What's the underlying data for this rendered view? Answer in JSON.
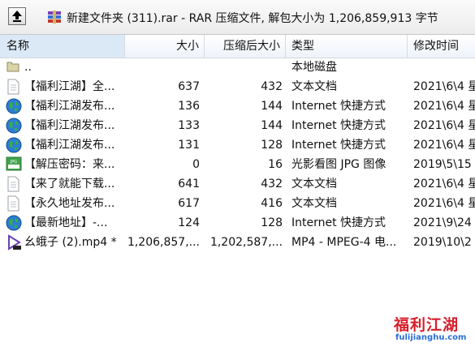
{
  "window": {
    "path_title": "新建文件夹 (311).rar - RAR 压缩文件, 解包大小为 1,206,859,913 字节"
  },
  "columns": {
    "name": "名称",
    "size": "大小",
    "packed": "压缩后大小",
    "type": "类型",
    "modified": "修改时间"
  },
  "files": [
    {
      "icon": "folder-icon",
      "name": "..",
      "size": "",
      "packed": "",
      "type": "本地磁盘",
      "modified": ""
    },
    {
      "icon": "text-document-icon",
      "name": "【福利江湖】全...",
      "size": "637",
      "packed": "432",
      "type": "文本文档",
      "modified": "2021\\6\\4 星"
    },
    {
      "icon": "internet-shortcut-icon",
      "name": "【福利江湖发布...",
      "size": "136",
      "packed": "144",
      "type": "Internet 快捷方式",
      "modified": "2021\\6\\4 星"
    },
    {
      "icon": "internet-shortcut-icon",
      "name": "【福利江湖发布...",
      "size": "133",
      "packed": "144",
      "type": "Internet 快捷方式",
      "modified": "2021\\6\\4 星"
    },
    {
      "icon": "internet-shortcut-icon",
      "name": "【福利江湖发布...",
      "size": "131",
      "packed": "128",
      "type": "Internet 快捷方式",
      "modified": "2021\\6\\4 星"
    },
    {
      "icon": "jpg-image-icon",
      "name": "【解压密码：来...",
      "size": "0",
      "packed": "16",
      "type": "光影看图 JPG 图像",
      "modified": "2019\\5\\15"
    },
    {
      "icon": "text-document-icon",
      "name": "【来了就能下载...",
      "size": "641",
      "packed": "432",
      "type": "文本文档",
      "modified": "2021\\6\\4 星"
    },
    {
      "icon": "text-document-icon",
      "name": "【永久地址发布...",
      "size": "617",
      "packed": "416",
      "type": "文本文档",
      "modified": "2021\\6\\4 星"
    },
    {
      "icon": "internet-shortcut-icon",
      "name": "【最新地址】-...",
      "size": "124",
      "packed": "128",
      "type": "Internet 快捷方式",
      "modified": "2021\\9\\24"
    },
    {
      "icon": "video-file-icon",
      "name": "幺蛾子 (2).mp4 *",
      "size": "1,206,857,...",
      "packed": "1,202,587,...",
      "type": "MP4 - MPEG-4 电...",
      "modified": "2019\\10\\2"
    }
  ],
  "watermark": {
    "logo_text": "福利江湖",
    "url": "fulijianghu.com"
  }
}
